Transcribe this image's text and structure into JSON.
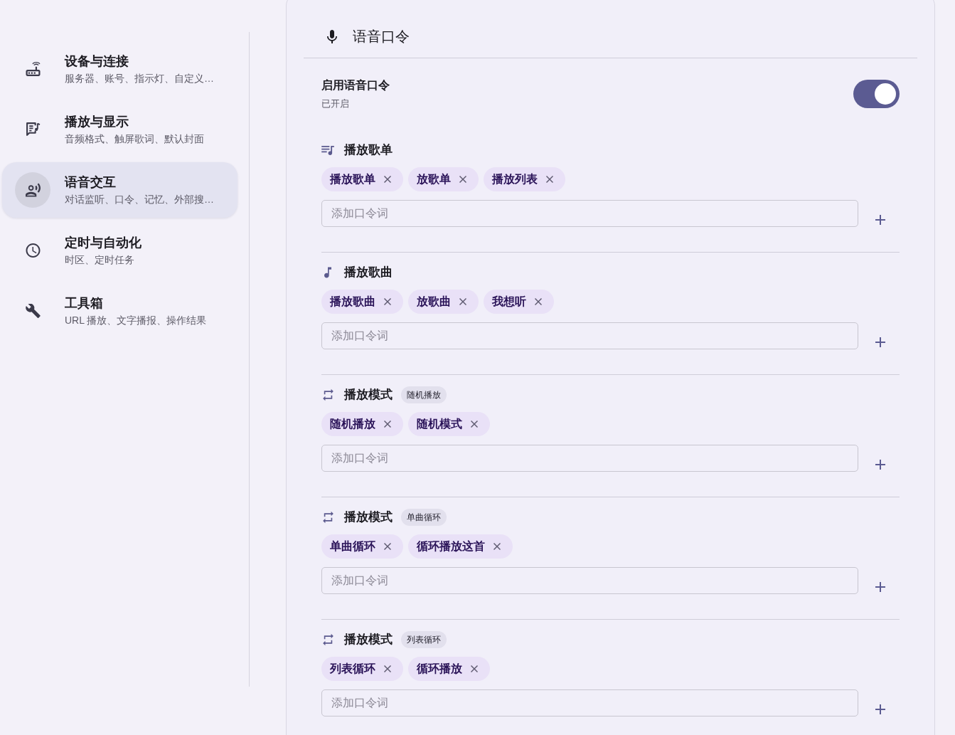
{
  "sidebar": {
    "items": [
      {
        "title": "设备与连接",
        "subtitle": "服务器、账号、指示灯、自定义…",
        "selected": false
      },
      {
        "title": "播放与显示",
        "subtitle": "音频格式、触屏歌词、默认封面",
        "selected": false
      },
      {
        "title": "语音交互",
        "subtitle": "对话监听、口令、记忆、外部搜…",
        "selected": true
      },
      {
        "title": "定时与自动化",
        "subtitle": "时区、定时任务",
        "selected": false
      },
      {
        "title": "工具箱",
        "subtitle": "URL 播放、文字播报、操作结果",
        "selected": false
      }
    ]
  },
  "panel": {
    "title": "语音口令",
    "enable": {
      "label": "启用语音口令",
      "status": "已开启",
      "on": true
    },
    "sections": [
      {
        "kind": "playlist",
        "title": "播放歌单",
        "keywords": [
          "播放歌单",
          "放歌单",
          "播放列表"
        ],
        "placeholder": "添加口令词"
      },
      {
        "kind": "song",
        "title": "播放歌曲",
        "keywords": [
          "播放歌曲",
          "放歌曲",
          "我想听"
        ],
        "placeholder": "添加口令词"
      },
      {
        "kind": "mode",
        "title": "播放模式",
        "badge": "随机播放",
        "keywords": [
          "随机播放",
          "随机模式"
        ],
        "placeholder": "添加口令词"
      },
      {
        "kind": "mode",
        "title": "播放模式",
        "badge": "单曲循环",
        "keywords": [
          "单曲循环",
          "循环播放这首"
        ],
        "placeholder": "添加口令词"
      },
      {
        "kind": "mode",
        "title": "播放模式",
        "badge": "列表循环",
        "keywords": [
          "列表循环",
          "循环播放"
        ],
        "placeholder": "添加口令词"
      }
    ]
  }
}
